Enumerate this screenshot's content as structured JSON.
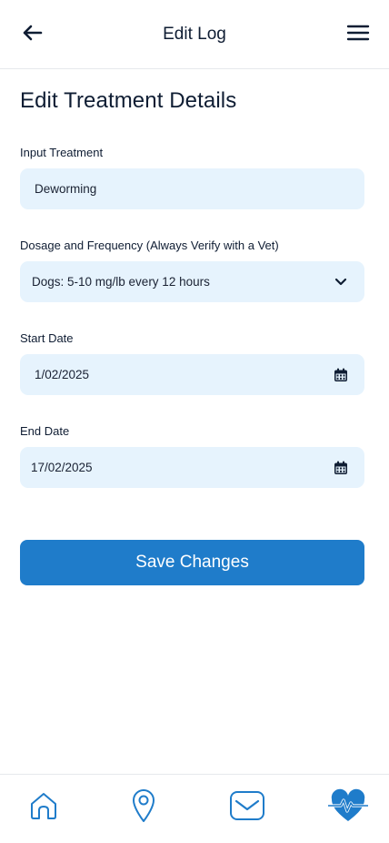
{
  "header": {
    "title": "Edit Log",
    "back_icon": "arrow-left-icon",
    "menu_icon": "hamburger-menu-icon"
  },
  "page": {
    "title": "Edit Treatment Details"
  },
  "form": {
    "treatment": {
      "label": "Input Treatment",
      "value": "Deworming"
    },
    "dosage": {
      "label": "Dosage and Frequency (Always Verify with a Vet)",
      "selected": "Dogs: 5-10 mg/lb every 12 hours",
      "icon": "chevron-down-icon"
    },
    "start_date": {
      "label": "Start Date",
      "value": "1/02/2025",
      "icon": "calendar-icon"
    },
    "end_date": {
      "label": "End Date",
      "value": "17/02/2025",
      "icon": "calendar-icon"
    },
    "save_label": "Save Changes"
  },
  "tabbar": {
    "items": [
      {
        "icon": "home-icon",
        "active": false
      },
      {
        "icon": "location-pin-icon",
        "active": false
      },
      {
        "icon": "mail-icon",
        "active": false
      },
      {
        "icon": "heart-pulse-icon",
        "active": true
      }
    ]
  },
  "colors": {
    "primary": "#1f7cca",
    "field_bg": "#e6f3fd",
    "text_dark": "#0f1d33",
    "icon_blue": "#1f7cca"
  }
}
